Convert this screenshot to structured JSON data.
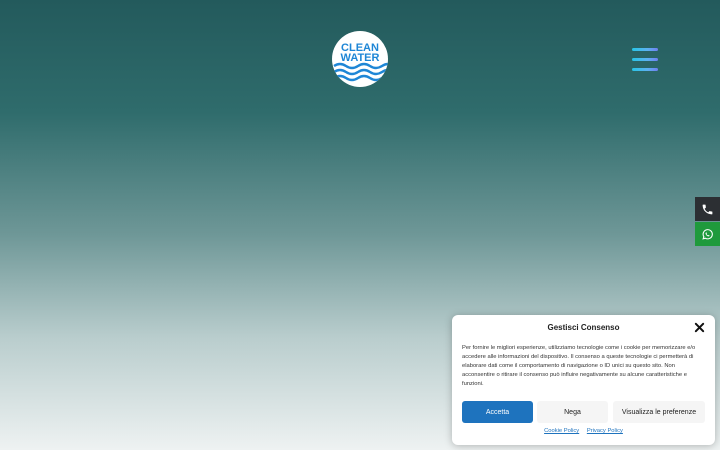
{
  "header": {
    "logo": {
      "line1": "CLEAN",
      "line2": "WATER"
    },
    "menu_icon": "hamburger-icon"
  },
  "side_contacts": {
    "phone_icon": "phone-icon",
    "whatsapp_icon": "whatsapp-icon"
  },
  "cookie_banner": {
    "title": "Gestisci Consenso",
    "text": "Per fornire le migliori esperienze, utilizziamo tecnologie come i cookie per memorizzare e/o accedere alle informazioni del dispositivo. Il consenso a queste tecnologie ci permetterà di elaborare dati come il comportamento di navigazione o ID unici su questo sito. Non acconsentire o ritirare il consenso può influire negativamente su alcune caratteristiche e funzioni.",
    "accept_label": "Accetta",
    "deny_label": "Nega",
    "preferences_label": "Visualizza le preferenze",
    "cookie_policy_label": "Cookie Policy",
    "privacy_policy_label": "Privacy Policy"
  },
  "colors": {
    "accent": "#1e73be",
    "whatsapp": "#1f9a3c",
    "phone_bg": "#2c2f33"
  }
}
